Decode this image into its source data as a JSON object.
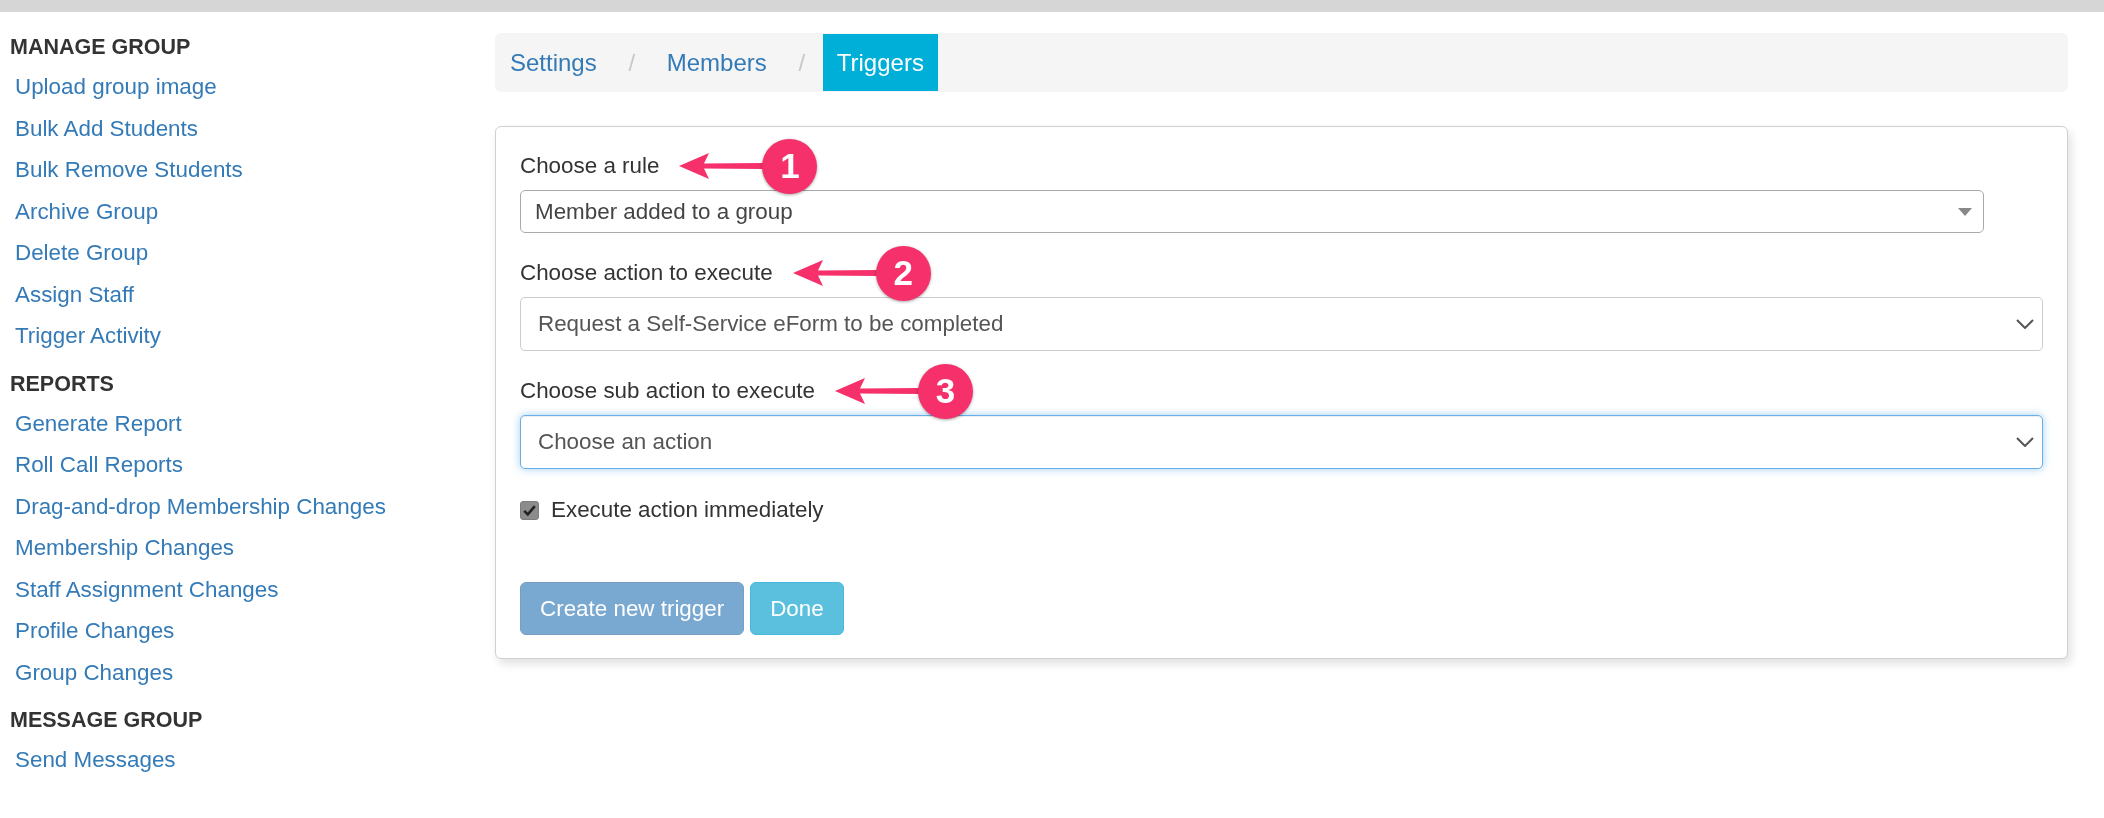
{
  "sidebar": {
    "sections": [
      {
        "title": "MANAGE GROUP",
        "links": [
          "Upload group image",
          "Bulk Add Students",
          "Bulk Remove Students",
          "Archive Group",
          "Delete Group",
          "Assign Staff",
          "Trigger Activity"
        ]
      },
      {
        "title": "REPORTS",
        "links": [
          "Generate Report",
          "Roll Call Reports",
          "Drag-and-drop Membership Changes",
          "Membership Changes",
          "Staff Assignment Changes",
          "Profile Changes",
          "Group Changes"
        ]
      },
      {
        "title": "MESSAGE GROUP",
        "links": [
          "Send Messages"
        ]
      }
    ]
  },
  "breadcrumb": [
    {
      "label": "Settings",
      "selected": false,
      "separator": "/"
    },
    {
      "label": "Members",
      "selected": false,
      "separator": "/"
    },
    {
      "label": "Triggers",
      "selected": true
    }
  ],
  "form": {
    "fields": [
      {
        "label": "Choose a rule",
        "callout": "1",
        "kind": "enhanced",
        "value": "Member added to a group",
        "focused": false
      },
      {
        "label": "Choose action to execute",
        "callout": "2",
        "kind": "native",
        "value": "Request a Self-Service eForm to be completed",
        "focused": false
      },
      {
        "label": "Choose sub action to execute",
        "callout": "3",
        "kind": "native",
        "value": "Choose an action",
        "focused": true
      }
    ],
    "checkbox": {
      "label": "Execute action immediately",
      "checked": true
    },
    "buttons": [
      {
        "label": "Create new trigger",
        "kind": "primary",
        "disabled": true
      },
      {
        "label": "Done",
        "kind": "info",
        "disabled": false
      }
    ]
  }
}
